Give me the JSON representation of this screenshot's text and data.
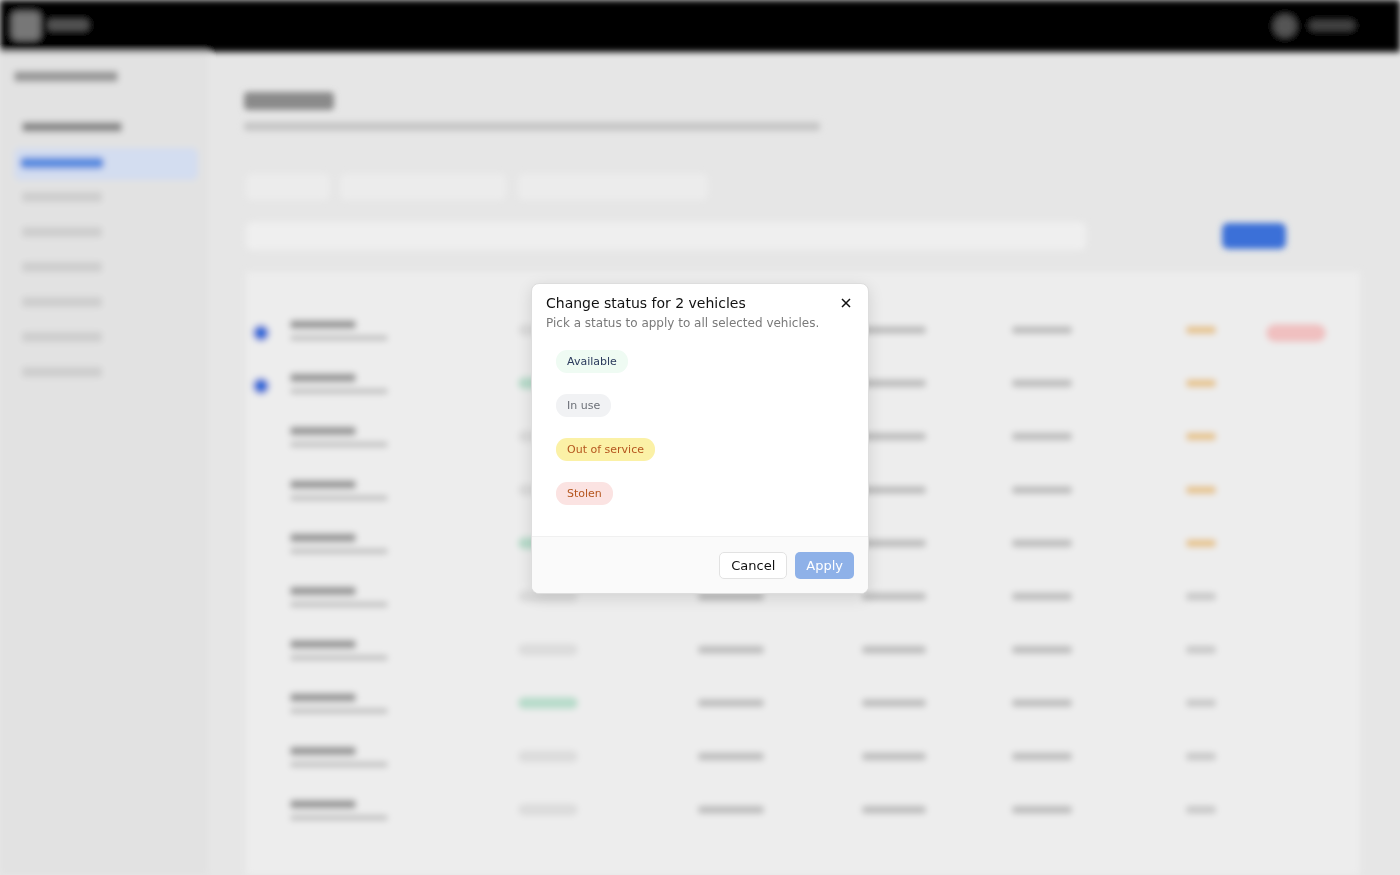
{
  "dialog": {
    "title": "Change status for 2 vehicles",
    "subtitle": "Pick a status to apply to all selected vehicles.",
    "options": [
      {
        "label": "Available",
        "color": "#effbf3",
        "kind": "success",
        "selected": false
      },
      {
        "label": "In use",
        "color": "#f1f2f4",
        "kind": "neutral",
        "selected": false
      },
      {
        "label": "Out of service",
        "color": "#fbf1a6",
        "kind": "warning",
        "selected": false
      },
      {
        "label": "Stolen",
        "color": "#fbe3e2",
        "kind": "danger",
        "selected": false
      }
    ],
    "buttons": [
      {
        "label": "Cancel",
        "kind": "secondary",
        "disabled": false
      },
      {
        "label": "Apply",
        "kind": "primary",
        "disabled": true
      }
    ]
  }
}
